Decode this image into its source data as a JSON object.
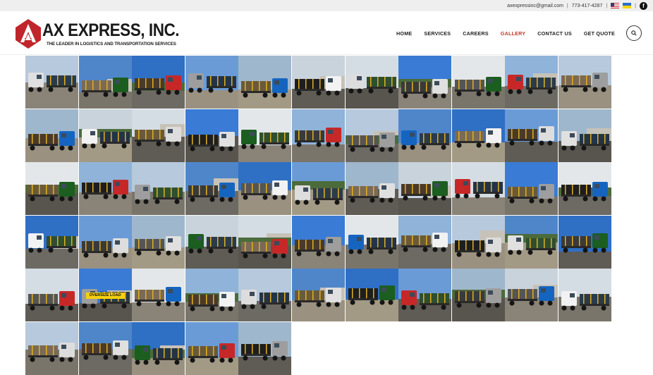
{
  "topbar": {
    "email": "axexpressinc@gmail.com",
    "phone": "773-417-4287",
    "sep": "|",
    "flags": [
      "us-flag-icon",
      "ukraine-flag-icon"
    ],
    "social": "facebook-icon"
  },
  "brand": {
    "name": "AX EXPRESS, INC.",
    "tagline": "THE LEADER IN LOGISTICS AND TRANSPORTATION SERVICES",
    "colors": {
      "red": "#c0252b",
      "dark": "#1a1a1a"
    }
  },
  "nav": {
    "items": [
      {
        "label": "HOME",
        "active": false
      },
      {
        "label": "SERVICES",
        "active": false
      },
      {
        "label": "CAREERS",
        "active": false
      },
      {
        "label": "GALLERY",
        "active": true
      },
      {
        "label": "CONTACT US",
        "active": false
      },
      {
        "label": "GET QUOTE",
        "active": false
      }
    ],
    "accent": "#c0392b",
    "search_icon": "search-icon"
  },
  "gallery": {
    "photo_count": 60,
    "visible_text": {
      "banner": "OVERSIZE LOAD"
    }
  }
}
